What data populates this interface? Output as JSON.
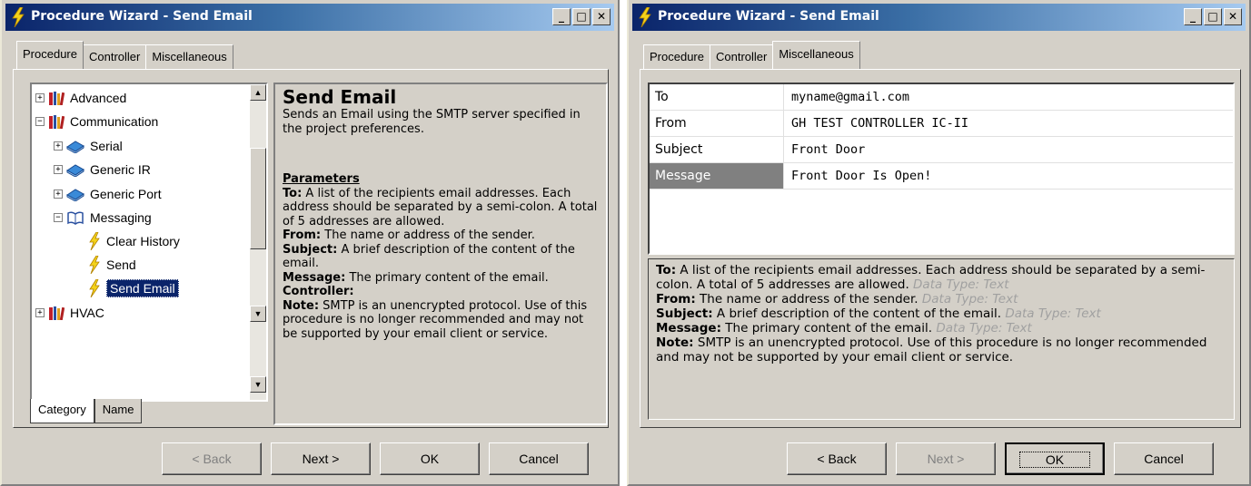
{
  "left": {
    "title": "Procedure Wizard - Send Email",
    "tabs": [
      "Procedure",
      "Controller",
      "Miscellaneous"
    ],
    "tree": [
      {
        "label": "Advanced"
      },
      {
        "label": "Communication"
      },
      {
        "label": "Serial"
      },
      {
        "label": "Generic IR"
      },
      {
        "label": "Generic Port"
      },
      {
        "label": "Messaging"
      },
      {
        "label": "Clear History"
      },
      {
        "label": "Send"
      },
      {
        "label": "Send Email"
      },
      {
        "label": "HVAC"
      }
    ],
    "bottom_tabs": [
      "Category",
      "Name"
    ],
    "desc": {
      "heading": "Send Email",
      "summary": "Sends an Email using the SMTP server specified in the project preferences.",
      "params_title": "Parameters",
      "to_label": "To:",
      "to_text": " A list of the recipients email addresses. Each address should be separated by a semi-colon. A total of 5 addresses are allowed.",
      "from_label": "From:",
      "from_text": " The name or address of the sender.",
      "subject_label": "Subject:",
      "subject_text": " A brief description of the content of the email.",
      "message_label": "Message:",
      "message_text": " The primary content of the email.",
      "controller_label": "Controller:",
      "note_label": "Note:",
      "note_text": " SMTP is an unencrypted protocol. Use of this procedure is no longer recommended and may not be supported by your email client or service."
    },
    "buttons": {
      "back": "< Back",
      "next": "Next >",
      "ok": "OK",
      "cancel": "Cancel"
    }
  },
  "right": {
    "title": "Procedure Wizard - Send Email",
    "tabs": [
      "Procedure",
      "Controller",
      "Miscellaneous"
    ],
    "params": [
      {
        "name": "To",
        "value": "myname@gmail.com"
      },
      {
        "name": "From",
        "value": "GH TEST CONTROLLER IC-II"
      },
      {
        "name": "Subject",
        "value": "Front Door"
      },
      {
        "name": "Message",
        "value": "Front Door Is Open!"
      }
    ],
    "desc": {
      "to_label": "To:",
      "to_text": " A list of the recipients email addresses. Each address should be separated by a semi-colon. A total of 5 addresses are allowed. ",
      "to_type": "Data Type: Text",
      "from_label": "From:",
      "from_text": " The name or address of the sender. ",
      "from_type": "Data Type: Text",
      "subject_label": "Subject:",
      "subject_text": " A brief description of the content of the email. ",
      "subject_type": "Data Type: Text",
      "message_label": "Message:",
      "message_text": " The primary content of the email. ",
      "message_type": "Data Type: Text",
      "note_label": "Note:",
      "note_text": " SMTP is an unencrypted protocol. Use of this procedure is no longer recommended and may not be supported by your email client or service."
    },
    "buttons": {
      "back": "< Back",
      "next": "Next >",
      "ok": "OK",
      "cancel": "Cancel"
    }
  }
}
